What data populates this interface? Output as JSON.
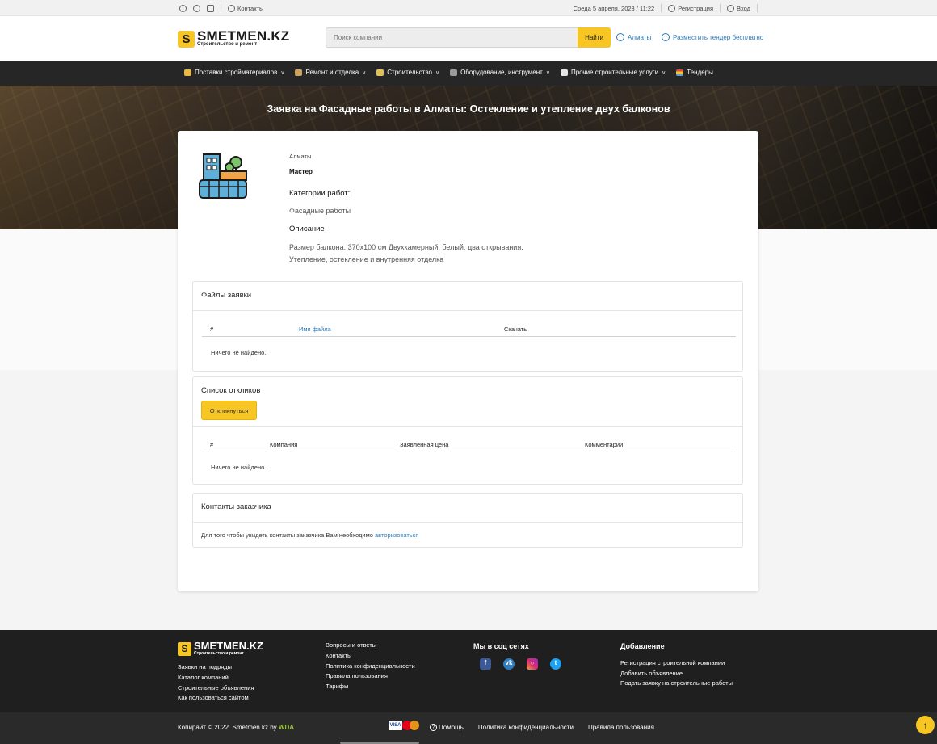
{
  "topbar": {
    "contacts": "Контакты",
    "datetime": "Среда 5 апреля, 2023 / 11:22",
    "register": "Регистрация",
    "login": "Вход"
  },
  "header": {
    "logo_letter": "S",
    "logo_name": "SMETMEN.KZ",
    "logo_sub": "Строительство и ремонт",
    "search_placeholder": "Поиск компании",
    "search_button": "Найти",
    "city": "Алматы",
    "post_tender": "Разместить тендер бесплатно"
  },
  "nav": {
    "items": [
      {
        "label": "Поставки стройматериалов",
        "icon": "materials-icon"
      },
      {
        "label": "Ремонт и отделка",
        "icon": "repair-icon"
      },
      {
        "label": "Строительство",
        "icon": "construction-icon"
      },
      {
        "label": "Оборудование, инструмент",
        "icon": "tools-icon"
      },
      {
        "label": "Прочие строительные услуги",
        "icon": "services-icon"
      },
      {
        "label": "Тендеры",
        "icon": "tenders-icon"
      }
    ]
  },
  "hero": {
    "title": "Заявка на Фасадные работы в Алматы: Остекление и утепление двух балконов"
  },
  "request": {
    "city": "Алматы",
    "role": "Мастер",
    "categories_heading": "Категории работ:",
    "category": "Фасадные работы",
    "description_heading": "Описание",
    "description_line1": "Размер балкона: 370х100 см Двухкамерный, белый, два открывания.",
    "description_line2": "Утепление, остекление и внутренняя отделка"
  },
  "files": {
    "heading": "Файлы заявки",
    "col_num": "#",
    "col_name": "Имя файла",
    "col_download": "Скачать",
    "empty": "Ничего не найдено."
  },
  "responses": {
    "heading": "Список откликов",
    "button": "Откликнуться",
    "col_num": "#",
    "col_company": "Компания",
    "col_price": "Заявленная цена",
    "col_comments": "Комментарии",
    "empty": "Ничего не найдено."
  },
  "contacts": {
    "heading": "Контакты заказчика",
    "text": "Для того чтобы увидеть контакты заказчика Вам необходимо",
    "link": "авторизоваться"
  },
  "footer": {
    "col1": [
      "Заявки на подряды",
      "Каталог компаний",
      "Строительные объявления",
      "Как пользоваться сайтом"
    ],
    "col2": [
      "Вопросы и ответы",
      "Контакты",
      "Политика конфиденциальности",
      "Правила пользования",
      "Тарифы"
    ],
    "social_heading": "Мы в соц сетях",
    "add_heading": "Добавление",
    "col4": [
      "Регистрация строительной компании",
      "Добавить объявление",
      "Подать заявку на строительные работы"
    ]
  },
  "bottom": {
    "copyright": "Копирайт © 2022. Smetmen.kz by",
    "brand": "WDA",
    "visa": "VISA",
    "help": "Помощь",
    "privacy": "Политика конфиденциальности",
    "rules": "Правила пользования"
  },
  "colors": {
    "accent": "#f7c623",
    "link": "#2a7ab8",
    "dark": "#262626"
  }
}
